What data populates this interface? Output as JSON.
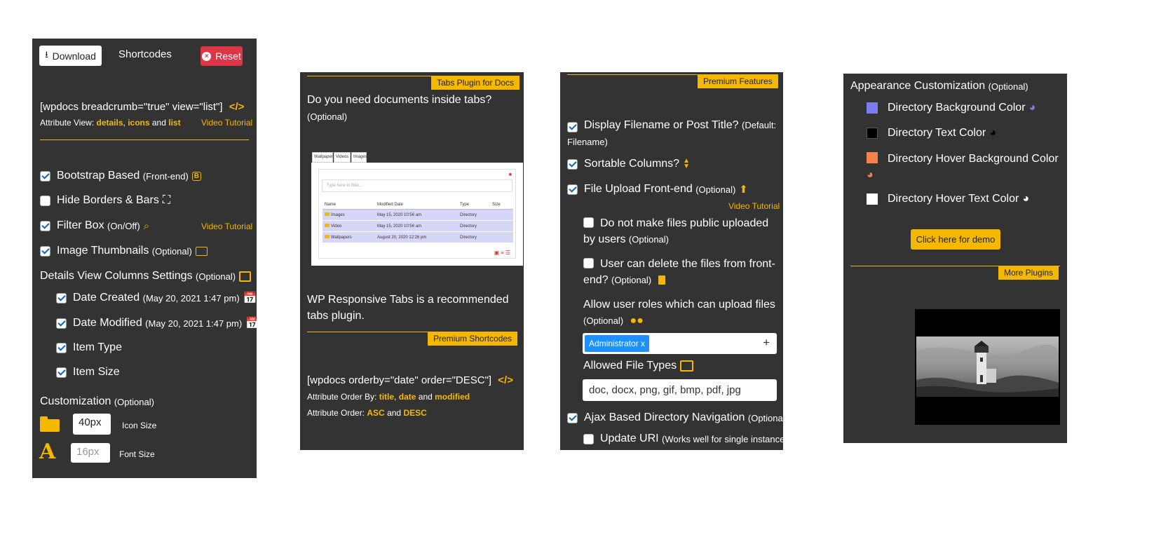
{
  "panel1": {
    "download_label": "Download",
    "shortcodes_label": "Shortcodes",
    "reset_label": "Reset",
    "shortcode_text": "[wpdocs breadcrumb=\"true\" view=\"list\"]",
    "attr_prefix": "Attribute View:",
    "attr_details": "details",
    "attr_icons": "icons",
    "attr_and": "and",
    "attr_list": "list",
    "video_tutorial": "Video Tutorial",
    "options": [
      {
        "label": "Bootstrap Based",
        "note": "(Front-end)",
        "checked": true
      },
      {
        "label": "Hide Borders & Bars",
        "note": "",
        "checked": false
      },
      {
        "label": "Filter Box",
        "note": "(On/Off)",
        "checked": true
      },
      {
        "label": "Image Thumbnails",
        "note": "(Optional)",
        "checked": true
      }
    ],
    "details_heading": "Details View Columns Settings",
    "details_note": "(Optional)",
    "columns": [
      {
        "label": "Date Created",
        "note": "(May 20, 2021 1:47 pm)",
        "checked": true
      },
      {
        "label": "Date Modified",
        "note": "(May 20, 2021 1:47 pm)",
        "checked": true
      },
      {
        "label": "Item Type",
        "note": "",
        "checked": true
      },
      {
        "label": "Item Size",
        "note": "",
        "checked": true
      }
    ],
    "customization_heading": "Customization",
    "customization_note": "(Optional)",
    "icon_size_value": "40px",
    "icon_size_label": "Icon Size",
    "font_size_placeholder": "16px",
    "font_size_label": "Font Size"
  },
  "panel2": {
    "badge_top": "Tabs Plugin for Docs",
    "question": "Do you need documents inside tabs?",
    "question_note": "(Optional)",
    "preview_tabs": [
      "Wallpapers",
      "Videos",
      "Images"
    ],
    "preview_search": "Type here to filter...",
    "preview_headers": [
      "Name",
      "Modified Date",
      "Type",
      "Size"
    ],
    "preview_rows": [
      [
        "Images",
        "May 15, 2020 10:56 am",
        "Directory",
        ""
      ],
      [
        "Video",
        "May 15, 2020 10:56 am",
        "Directory",
        ""
      ],
      [
        "Wallpapers",
        "August 20, 2020 12:26 pm",
        "Directory",
        ""
      ]
    ],
    "recommend": "WP Responsive Tabs is a recommended tabs plugin.",
    "badge_mid": "Premium Shortcodes",
    "shortcode_text": "[wpdocs orderby=\"date\" order=\"DESC\"]",
    "orderby_prefix": "Attribute Order By:",
    "orderby_title": "title",
    "orderby_date": "date",
    "orderby_and": "and",
    "orderby_modified": "modified",
    "order_prefix": "Attribute Order:",
    "order_asc": "ASC",
    "order_and": "and",
    "order_desc": "DESC"
  },
  "panel3": {
    "badge": "Premium Features",
    "display_filename": "Display Filename or Post Title?",
    "display_filename_note": "(Default: Filename)",
    "sortable": "Sortable Columns?",
    "upload": "File Upload Front-end",
    "upload_note": "(Optional)",
    "video_tutorial": "Video Tutorial",
    "not_public": "Do not make files public uploaded by users",
    "not_public_note": "(Optional)",
    "can_delete": "User can delete the files from front-end?",
    "can_delete_note": "(Optional)",
    "roles_label": "Allow user roles which can upload files",
    "roles_note": "(Optional)",
    "role_chip": "Administrator x",
    "plus": "+",
    "file_types_label": "Allowed File Types",
    "file_types_value": "doc, docx, png, gif, bmp, pdf, jpg",
    "ajax": "Ajax Based Directory Navigation",
    "ajax_note": "(Optional)",
    "update_uri": "Update URI",
    "update_uri_note": "(Works well for single instance)"
  },
  "panel4": {
    "heading": "Appearance Customization",
    "heading_note": "(Optional)",
    "colors": [
      {
        "label": "Directory Background Color",
        "swatch": "#7b7bf2"
      },
      {
        "label": "Directory Text Color",
        "swatch": "#000000"
      },
      {
        "label": "Directory Hover Background Color",
        "swatch": "#f5824a"
      },
      {
        "label": "Directory Hover Text Color",
        "swatch": "#ffffff"
      }
    ],
    "demo_button": "Click here for demo",
    "more_plugins": "More Plugins"
  },
  "colors": {
    "accent": "#f5b800",
    "panel": "#333333",
    "danger": "#dc3545",
    "chip": "#1e90ff"
  }
}
